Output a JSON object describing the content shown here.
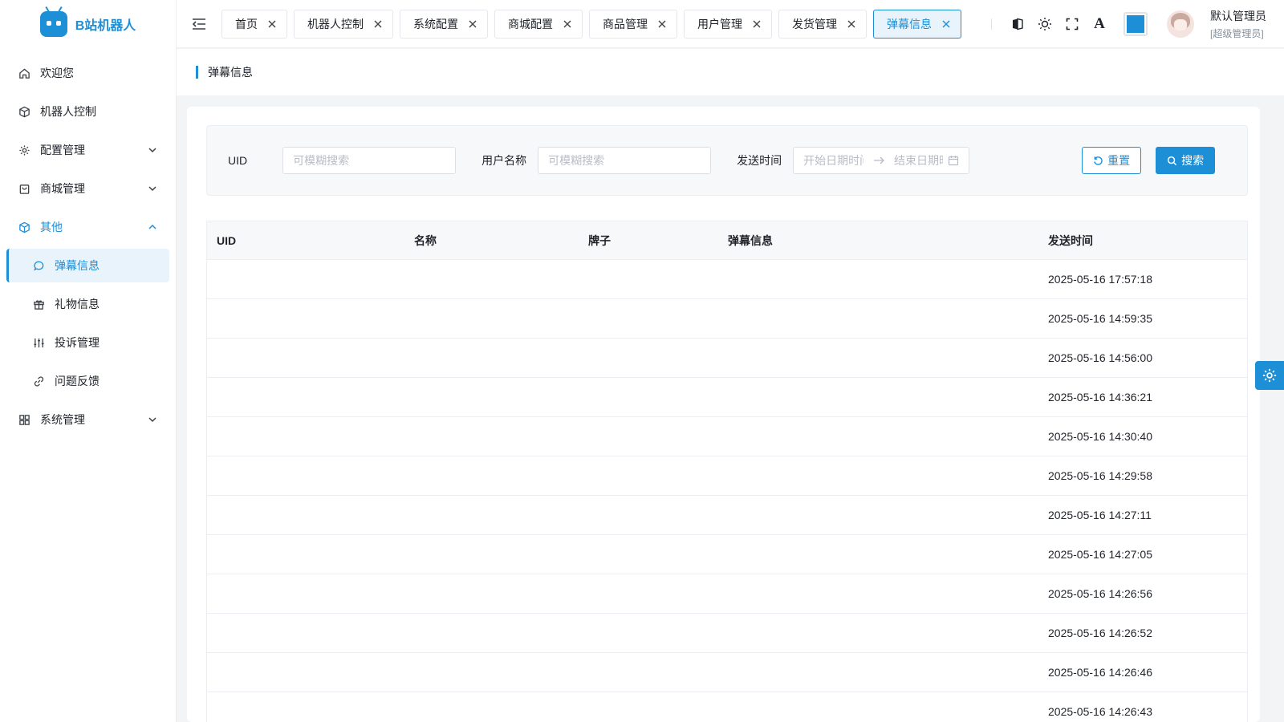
{
  "app": {
    "name": "B站机器人",
    "accent": "#1d8fd6"
  },
  "sidebar": {
    "items": [
      {
        "label": "欢迎您",
        "icon": "home-icon"
      },
      {
        "label": "机器人控制",
        "icon": "cube-icon"
      },
      {
        "label": "配置管理",
        "icon": "gear-icon",
        "expandable": true
      },
      {
        "label": "商城管理",
        "icon": "bag-icon",
        "expandable": true
      },
      {
        "label": "其他",
        "icon": "box-icon",
        "expanded": true,
        "children": [
          {
            "label": "弹幕信息",
            "icon": "chat-icon",
            "active": true
          },
          {
            "label": "礼物信息",
            "icon": "gift-icon"
          },
          {
            "label": "投诉管理",
            "icon": "sliders-icon"
          },
          {
            "label": "问题反馈",
            "icon": "link-icon"
          }
        ]
      },
      {
        "label": "系统管理",
        "icon": "grid-icon",
        "expandable": true
      }
    ]
  },
  "header": {
    "tabs": [
      "首页",
      "机器人控制",
      "系统配置",
      "商城配置",
      "商品管理",
      "用户管理",
      "发货管理",
      "弹幕信息"
    ],
    "active_tab": "弹幕信息",
    "user": {
      "name": "默认管理员",
      "role": "[超级管理员]"
    },
    "theme_color": "#1d8fd6"
  },
  "page": {
    "title": "弹幕信息"
  },
  "search": {
    "uid_label": "UID",
    "uid_placeholder": "可模糊搜索",
    "username_label": "用户名称",
    "username_placeholder": "可模糊搜索",
    "time_label": "发送时间",
    "start_placeholder": "开始日期时间",
    "end_placeholder": "结束日期时间",
    "reset_label": "重置",
    "search_label": "搜索"
  },
  "table": {
    "columns": [
      "UID",
      "名称",
      "牌子",
      "弹幕信息",
      "发送时间"
    ],
    "rows": [
      {
        "uid": "",
        "name": "",
        "brand": "",
        "msg": "",
        "time": "2025-05-16 17:57:18"
      },
      {
        "uid": "",
        "name": "",
        "brand": "",
        "msg": "",
        "time": "2025-05-16 14:59:35"
      },
      {
        "uid": "",
        "name": "",
        "brand": "",
        "msg": "",
        "time": "2025-05-16 14:56:00"
      },
      {
        "uid": "",
        "name": "",
        "brand": "",
        "msg": "",
        "time": "2025-05-16 14:36:21"
      },
      {
        "uid": "",
        "name": "",
        "brand": "",
        "msg": "",
        "time": "2025-05-16 14:30:40"
      },
      {
        "uid": "",
        "name": "",
        "brand": "",
        "msg": "",
        "time": "2025-05-16 14:29:58"
      },
      {
        "uid": "",
        "name": "",
        "brand": "",
        "msg": "",
        "time": "2025-05-16 14:27:11"
      },
      {
        "uid": "",
        "name": "",
        "brand": "",
        "msg": "",
        "time": "2025-05-16 14:27:05"
      },
      {
        "uid": "",
        "name": "",
        "brand": "",
        "msg": "",
        "time": "2025-05-16 14:26:56"
      },
      {
        "uid": "",
        "name": "",
        "brand": "",
        "msg": "",
        "time": "2025-05-16 14:26:52"
      },
      {
        "uid": "",
        "name": "",
        "brand": "",
        "msg": "",
        "time": "2025-05-16 14:26:46"
      },
      {
        "uid": "",
        "name": "",
        "brand": "",
        "msg": "",
        "time": "2025-05-16 14:26:43"
      }
    ]
  }
}
